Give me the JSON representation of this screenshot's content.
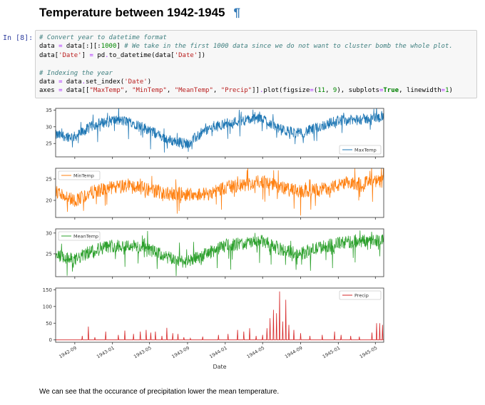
{
  "heading": {
    "title": "Temperature between 1942-1945",
    "anchor": "¶"
  },
  "cell": {
    "prompt": "In [8]:",
    "code_lines": [
      [
        {
          "t": "# Convert year to datetime format",
          "c": "cm"
        }
      ],
      [
        {
          "t": "data "
        },
        {
          "t": "=",
          "c": "op"
        },
        {
          "t": " data[:][:"
        },
        {
          "t": "1000",
          "c": "nm"
        },
        {
          "t": "] "
        },
        {
          "t": "# We take in the first 1000 data since we do not want to cluster bomb the whole plot.",
          "c": "cm"
        }
      ],
      [
        {
          "t": "data["
        },
        {
          "t": "'Date'",
          "c": "st"
        },
        {
          "t": "] "
        },
        {
          "t": "=",
          "c": "op"
        },
        {
          "t": " pd"
        },
        {
          "t": ".",
          "c": "op"
        },
        {
          "t": "to_datetime(data["
        },
        {
          "t": "'Date'",
          "c": "st"
        },
        {
          "t": "])"
        }
      ],
      [
        {
          "t": ""
        }
      ],
      [
        {
          "t": "# Indexing the year",
          "c": "cm"
        }
      ],
      [
        {
          "t": "data "
        },
        {
          "t": "=",
          "c": "op"
        },
        {
          "t": " data"
        },
        {
          "t": ".",
          "c": "op"
        },
        {
          "t": "set_index("
        },
        {
          "t": "'Date'",
          "c": "st"
        },
        {
          "t": ")"
        }
      ],
      [
        {
          "t": "axes "
        },
        {
          "t": "=",
          "c": "op"
        },
        {
          "t": " data[["
        },
        {
          "t": "\"MaxTemp\"",
          "c": "st"
        },
        {
          "t": ", "
        },
        {
          "t": "\"MinTemp\"",
          "c": "st"
        },
        {
          "t": ", "
        },
        {
          "t": "\"MeanTemp\"",
          "c": "st"
        },
        {
          "t": ", "
        },
        {
          "t": "\"Precip\"",
          "c": "st"
        },
        {
          "t": "]]"
        },
        {
          "t": ".",
          "c": "op"
        },
        {
          "t": "plot(figsize"
        },
        {
          "t": "=",
          "c": "op"
        },
        {
          "t": "("
        },
        {
          "t": "11",
          "c": "nm"
        },
        {
          "t": ", "
        },
        {
          "t": "9",
          "c": "nm"
        },
        {
          "t": "), subplots"
        },
        {
          "t": "=",
          "c": "op"
        },
        {
          "t": "True",
          "c": "kw"
        },
        {
          "t": ", linewidth"
        },
        {
          "t": "=",
          "c": "op"
        },
        {
          "t": "1",
          "c": "nm"
        },
        {
          "t": ")"
        }
      ]
    ]
  },
  "chart_data": {
    "type": "line",
    "xlabel": "Date",
    "x_range": [
      "1942-07-01",
      "1945-05-28"
    ],
    "x_ticks": [
      "1942-09",
      "1943-01",
      "1943-05",
      "1943-09",
      "1944-01",
      "1944-05",
      "1944-09",
      "1945-01",
      "1945-05"
    ],
    "grid": false,
    "subplots": [
      {
        "name": "MaxTemp",
        "color": "#1f77b4",
        "yticks": [
          25,
          30,
          35
        ],
        "ylim": [
          21,
          35.5
        ],
        "legend": "lower-right",
        "knots": [
          [
            "1942-07-01",
            27.5
          ],
          [
            "1942-09-01",
            27
          ],
          [
            "1942-11-01",
            30.5
          ],
          [
            "1943-01-01",
            32
          ],
          [
            "1943-03-01",
            31.5
          ],
          [
            "1943-05-01",
            29
          ],
          [
            "1943-07-01",
            26
          ],
          [
            "1943-09-01",
            25
          ],
          [
            "1943-11-01",
            29
          ],
          [
            "1944-01-01",
            31
          ],
          [
            "1944-03-01",
            32
          ],
          [
            "1944-05-01",
            32.5
          ],
          [
            "1944-07-01",
            29
          ],
          [
            "1944-09-01",
            28
          ],
          [
            "1944-11-01",
            30
          ],
          [
            "1945-01-01",
            32
          ],
          [
            "1945-03-01",
            32
          ],
          [
            "1945-05-28",
            33
          ]
        ]
      },
      {
        "name": "MinTemp",
        "color": "#ff7f0e",
        "yticks": [
          20,
          25
        ],
        "ylim": [
          16,
          27.5
        ],
        "legend": "upper-left",
        "knots": [
          [
            "1942-07-01",
            22
          ],
          [
            "1942-09-01",
            20
          ],
          [
            "1942-11-01",
            22
          ],
          [
            "1943-01-01",
            23
          ],
          [
            "1943-03-01",
            23.5
          ],
          [
            "1943-05-01",
            22.5
          ],
          [
            "1943-07-01",
            21.5
          ],
          [
            "1943-09-01",
            21.5
          ],
          [
            "1943-11-01",
            21.5
          ],
          [
            "1944-01-01",
            23
          ],
          [
            "1944-03-01",
            23.5
          ],
          [
            "1944-05-01",
            24.5
          ],
          [
            "1944-07-01",
            23
          ],
          [
            "1944-09-01",
            22
          ],
          [
            "1944-11-01",
            22.5
          ],
          [
            "1945-01-01",
            23.5
          ],
          [
            "1945-03-01",
            24
          ],
          [
            "1945-05-28",
            24.5
          ]
        ]
      },
      {
        "name": "MeanTemp",
        "color": "#2ca02c",
        "yticks": [
          25,
          30
        ],
        "ylim": [
          19.5,
          31
        ],
        "legend": "upper-left",
        "knots": [
          [
            "1942-07-01",
            24.5
          ],
          [
            "1942-09-01",
            23.5
          ],
          [
            "1942-11-01",
            26
          ],
          [
            "1943-01-01",
            27
          ],
          [
            "1943-03-01",
            27
          ],
          [
            "1943-05-01",
            26
          ],
          [
            "1943-07-01",
            24
          ],
          [
            "1943-09-01",
            23
          ],
          [
            "1943-11-01",
            25
          ],
          [
            "1944-01-01",
            27
          ],
          [
            "1944-03-01",
            27.5
          ],
          [
            "1944-05-01",
            28
          ],
          [
            "1944-07-01",
            26
          ],
          [
            "1944-09-01",
            25
          ],
          [
            "1944-11-01",
            26.5
          ],
          [
            "1945-01-01",
            27.5
          ],
          [
            "1945-03-01",
            28
          ],
          [
            "1945-05-28",
            28.5
          ]
        ]
      },
      {
        "name": "Precip",
        "color": "#d62728",
        "yticks": [
          0,
          50,
          100,
          150
        ],
        "ylim": [
          -7,
          155
        ],
        "legend": "upper-right",
        "spikes": [
          [
            "1942-09-25",
            12
          ],
          [
            "1942-10-15",
            40
          ],
          [
            "1942-11-05",
            8
          ],
          [
            "1942-12-10",
            25
          ],
          [
            "1943-01-20",
            15
          ],
          [
            "1943-02-10",
            28
          ],
          [
            "1943-03-10",
            18
          ],
          [
            "1943-04-01",
            25
          ],
          [
            "1943-04-20",
            30
          ],
          [
            "1943-05-05",
            22
          ],
          [
            "1943-05-20",
            25
          ],
          [
            "1943-06-10",
            12
          ],
          [
            "1943-06-26",
            36
          ],
          [
            "1943-07-15",
            20
          ],
          [
            "1943-08-01",
            18
          ],
          [
            "1943-08-20",
            8
          ],
          [
            "1943-09-10",
            5
          ],
          [
            "1943-10-20",
            10
          ],
          [
            "1943-12-10",
            15
          ],
          [
            "1944-01-10",
            18
          ],
          [
            "1944-02-10",
            30
          ],
          [
            "1944-03-01",
            25
          ],
          [
            "1944-03-20",
            35
          ],
          [
            "1944-04-10",
            12
          ],
          [
            "1944-05-01",
            15
          ],
          [
            "1944-05-15",
            35
          ],
          [
            "1944-05-25",
            65
          ],
          [
            "1944-06-05",
            90
          ],
          [
            "1944-06-15",
            80
          ],
          [
            "1944-06-25",
            145
          ],
          [
            "1944-07-05",
            55
          ],
          [
            "1944-07-15",
            120
          ],
          [
            "1944-07-25",
            45
          ],
          [
            "1944-08-10",
            30
          ],
          [
            "1944-09-01",
            20
          ],
          [
            "1944-10-01",
            12
          ],
          [
            "1944-11-10",
            15
          ],
          [
            "1944-12-20",
            25
          ],
          [
            "1945-01-10",
            15
          ],
          [
            "1945-02-10",
            12
          ],
          [
            "1945-03-10",
            10
          ],
          [
            "1945-04-20",
            22
          ],
          [
            "1945-05-05",
            50
          ],
          [
            "1945-05-15",
            50
          ],
          [
            "1945-05-24",
            45
          ]
        ]
      }
    ]
  },
  "output": {
    "text": "We can see that the occurance of precipitation lower the mean temperature."
  }
}
